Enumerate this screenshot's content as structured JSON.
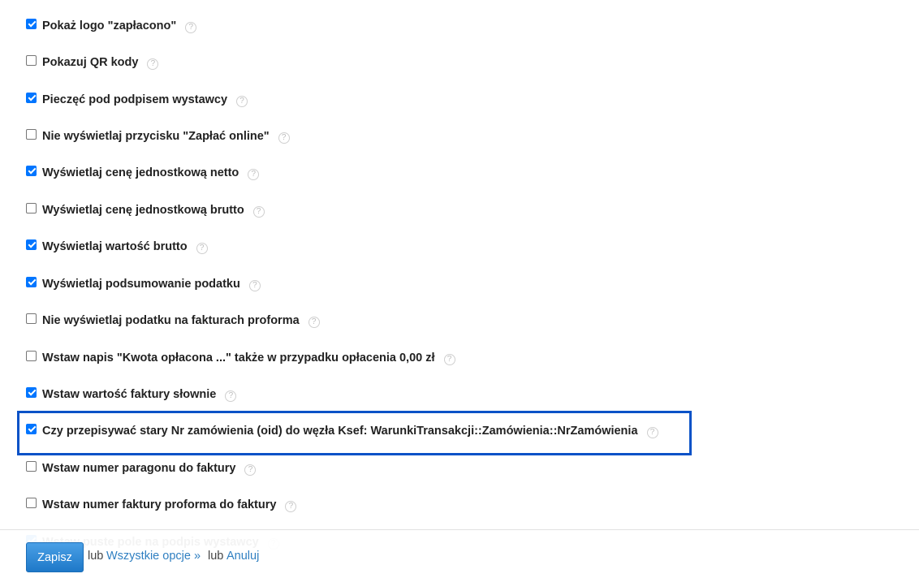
{
  "options": [
    {
      "label": "Pokaż logo \"zapłacono\"",
      "checked": true,
      "help_icon": "question-circle-icon"
    },
    {
      "label": "Pokazuj QR kody",
      "checked": false,
      "help_icon": "question-circle-icon"
    },
    {
      "label": "Pieczęć pod podpisem wystawcy",
      "checked": true,
      "help_icon": "question-circle-icon"
    },
    {
      "label": "Nie wyświetlaj przycisku \"Zapłać online\"",
      "checked": false,
      "help_icon": "question-circle-icon"
    },
    {
      "label": "Wyświetlaj cenę jednostkową netto",
      "checked": true,
      "help_icon": "question-circle-icon"
    },
    {
      "label": "Wyświetlaj cenę jednostkową brutto",
      "checked": false,
      "help_icon": "question-circle-icon"
    },
    {
      "label": "Wyświetlaj wartość brutto",
      "checked": true,
      "help_icon": "question-circle-icon"
    },
    {
      "label": "Wyświetlaj podsumowanie podatku",
      "checked": true,
      "help_icon": "question-circle-icon"
    },
    {
      "label": "Nie wyświetlaj podatku na fakturach proforma",
      "checked": false,
      "help_icon": "question-circle-icon"
    },
    {
      "label": "Wstaw napis \"Kwota opłacona ...\" także w przypadku opłacenia 0,00 zł",
      "checked": false,
      "help_icon": "question-circle-icon"
    },
    {
      "label": "Wstaw wartość faktury słownie",
      "checked": true,
      "help_icon": "question-circle-icon"
    },
    {
      "label": "Czy przepisywać stary Nr zamówienia (oid) do węzła Ksef: WarunkiTransakcji::Zamówienia::NrZamówienia",
      "checked": true,
      "help_icon": "question-circle-icon",
      "highlighted": true
    },
    {
      "label": "Wstaw numer paragonu do faktury",
      "checked": false,
      "help_icon": "question-circle-icon"
    },
    {
      "label": "Wstaw numer faktury proforma do faktury",
      "checked": false,
      "help_icon": "question-circle-icon"
    },
    {
      "label": "Wstaw puste pole na podpis wystawcy",
      "checked": true,
      "help_icon": "question-circle-icon",
      "partially_hidden": true
    }
  ],
  "help_glyph": "?",
  "highlight_color": "#0a52c7",
  "checkbox_color": "#0075ff",
  "footer": {
    "save_label": "Zapisz",
    "or_1": "lub",
    "all_options_link": "Wszystkie opcje »",
    "or_2": "lub",
    "cancel_link": "Anuluj"
  }
}
